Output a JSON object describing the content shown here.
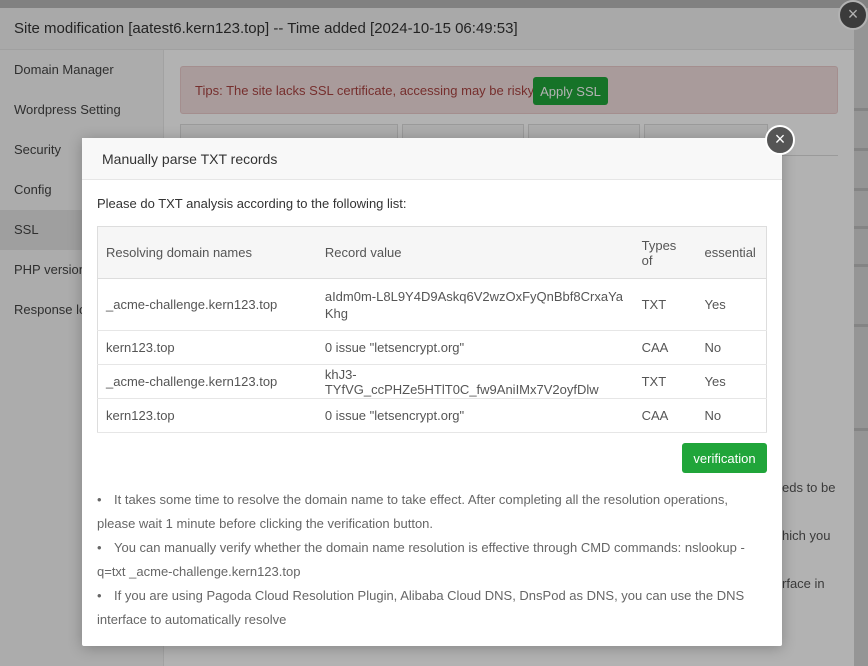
{
  "window": {
    "title": "Site modification [aatest6.kern123.top] -- Time added [2024-10-15 06:49:53]",
    "close_glyph": "×"
  },
  "sidebar": {
    "items": [
      {
        "label": "Domain Manager"
      },
      {
        "label": "Wordpress Setting"
      },
      {
        "label": "Security"
      },
      {
        "label": "Config"
      },
      {
        "label": "SSL"
      },
      {
        "label": "PHP version"
      },
      {
        "label": "Response log"
      }
    ],
    "active": "SSL"
  },
  "tips": {
    "text": "Tips: The site lacks SSL certificate, accessing may be risky.",
    "apply_ssl_label": "Apply SSL"
  },
  "background_right_text": {
    "line1": "eds to be",
    "line2": "hich you",
    "line3": "rface in"
  },
  "modal": {
    "title": "Manually parse TXT records",
    "close_glyph": "×",
    "instruction": "Please do TXT analysis according to the following list:",
    "columns": [
      "Resolving domain names",
      "Record value",
      "Types of",
      "essential"
    ],
    "rows": [
      {
        "domain": "_acme-challenge.kern123.top",
        "value": "aIdm0m-L8L9Y4D9Askq6V2wzOxFyQnBbf8CrxaYaKhg",
        "type": "TXT",
        "essential": "Yes"
      },
      {
        "domain": "kern123.top",
        "value": "0 issue \"letsencrypt.org\"",
        "type": "CAA",
        "essential": "No"
      },
      {
        "domain": "_acme-challenge.kern123.top",
        "value": "khJ3-TYfVG_ccPHZe5HTlT0C_fw9AniIMx7V2oyfDlw",
        "type": "TXT",
        "essential": "Yes"
      },
      {
        "domain": "kern123.top",
        "value": "0 issue \"letsencrypt.org\"",
        "type": "CAA",
        "essential": "No"
      }
    ],
    "verify_label": "verification",
    "notes": [
      "It takes some time to resolve the domain name to take effect. After completing all the resolution operations, please wait 1 minute before clicking the verification button.",
      "You can manually verify whether the domain name resolution is effective through CMD commands: nslookup -q=txt _acme-challenge.kern123.top",
      "If you are using Pagoda Cloud Resolution Plugin, Alibaba Cloud DNS, DnsPod as DNS, you can use the DNS interface to automatically resolve"
    ],
    "bullet": "•"
  },
  "colors": {
    "accent_green": "#20a53a",
    "tips_bg": "#f2dede",
    "tips_text": "#a94442"
  }
}
